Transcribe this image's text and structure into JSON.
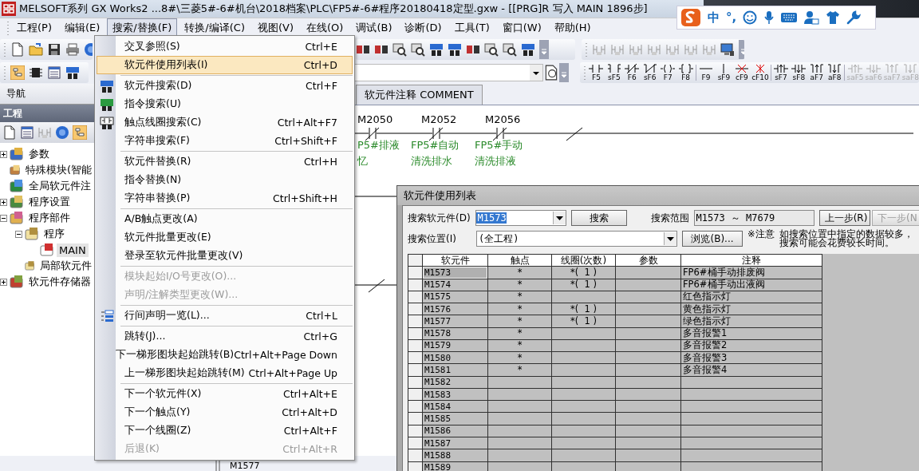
{
  "window": {
    "title": "MELSOFT系列 GX Works2 ...8#\\三菱5#-6#机台\\2018档案\\PLC\\FP5#-6#程序20180418定型.gxw - [[PRG]R 写入 MAIN 1896步]"
  },
  "ime_bar": {
    "mode": "中",
    "punctuation": "°,"
  },
  "menu_bar": [
    {
      "label": "工程(P)",
      "selected": false
    },
    {
      "label": "编辑(E)",
      "selected": false
    },
    {
      "label": "搜索/替换(F)",
      "selected": true
    },
    {
      "label": "转换/编译(C)",
      "selected": false
    },
    {
      "label": "视图(V)",
      "selected": false
    },
    {
      "label": "在线(O)",
      "selected": false
    },
    {
      "label": "调试(B)",
      "selected": false
    },
    {
      "label": "诊断(D)",
      "selected": false
    },
    {
      "label": "工具(T)",
      "selected": false
    },
    {
      "label": "窗口(W)",
      "selected": false
    },
    {
      "label": "帮助(H)",
      "selected": false
    }
  ],
  "menu": [
    {
      "kind": "item",
      "label": "交叉参照(S)",
      "shortcut": "Ctrl+E",
      "selected": false,
      "disabled": false
    },
    {
      "kind": "item",
      "label": "软元件使用列表(I)",
      "shortcut": "Ctrl+D",
      "selected": true,
      "disabled": false
    },
    {
      "kind": "separator"
    },
    {
      "kind": "dev-item",
      "label": "软元件搜索(D)",
      "shortcut": "Ctrl+F",
      "selected": false,
      "disabled": false
    },
    {
      "kind": "instruction-item",
      "label": "指令搜索(U)",
      "selected": false,
      "disabled": false
    },
    {
      "kind": "contact-item",
      "label": "触点线圈搜索(C)",
      "shortcut": "Ctrl+Alt+F7",
      "selected": false,
      "disabled": false
    },
    {
      "kind": "item",
      "label": "字符串搜索(F)",
      "shortcut": "Ctrl+Shift+F",
      "selected": false,
      "disabled": false
    },
    {
      "kind": "separator"
    },
    {
      "kind": "item",
      "label": "软元件替换(R)",
      "shortcut": "Ctrl+H",
      "selected": false,
      "disabled": false
    },
    {
      "kind": "item",
      "label": "指令替换(N)",
      "selected": false,
      "disabled": false
    },
    {
      "kind": "item",
      "label": "字符串替换(P)",
      "shortcut": "Ctrl+Shift+H",
      "selected": false,
      "disabled": false
    },
    {
      "kind": "separator"
    },
    {
      "kind": "item",
      "label": "A/B触点更改(A)",
      "selected": false,
      "disabled": false
    },
    {
      "kind": "item",
      "label": "软元件批量更改(E)",
      "selected": false,
      "disabled": false
    },
    {
      "kind": "item",
      "label": "登录至软元件批量更改(V)",
      "selected": false,
      "disabled": false
    },
    {
      "kind": "separator"
    },
    {
      "kind": "item",
      "label": "模块起始I/O号更改(O)...",
      "selected": false,
      "disabled": true
    },
    {
      "kind": "item",
      "label": "声明/注解类型更改(W)...",
      "selected": false,
      "disabled": true
    },
    {
      "kind": "separator"
    },
    {
      "kind": "statement-item",
      "label": "行间声明一览(L)...",
      "shortcut": "Ctrl+L",
      "selected": false,
      "disabled": false
    },
    {
      "kind": "separator"
    },
    {
      "kind": "item",
      "label": "跳转(J)...",
      "shortcut": "Ctrl+G",
      "selected": false,
      "disabled": false
    },
    {
      "kind": "item",
      "label": "下一梯形图块起始跳转(B)",
      "shortcut": "Ctrl+Alt+Page Down",
      "selected": false,
      "disabled": false
    },
    {
      "kind": "item",
      "label": "上一梯形图块起始跳转(M)",
      "shortcut": "Ctrl+Alt+Page Up",
      "selected": false,
      "disabled": false
    },
    {
      "kind": "separator"
    },
    {
      "kind": "item",
      "label": "下一个软元件(X)",
      "shortcut": "Ctrl+Alt+E",
      "selected": false,
      "disabled": false
    },
    {
      "kind": "item",
      "label": "下一个触点(Y)",
      "shortcut": "Ctrl+Alt+D",
      "selected": false,
      "disabled": false
    },
    {
      "kind": "item",
      "label": "下一个线圈(Z)",
      "shortcut": "Ctrl+Alt+F",
      "selected": false,
      "disabled": false
    },
    {
      "kind": "item",
      "label": "后退(K)",
      "shortcut": "Ctrl+Alt+R",
      "selected": false,
      "disabled": true
    }
  ],
  "ladder_tools": [
    [
      {
        "label": "F5",
        "kind": "open",
        "disabled": false
      },
      {
        "label": "sF5",
        "kind": "open-branch",
        "disabled": false
      },
      {
        "label": "F6",
        "kind": "closed",
        "disabled": false
      },
      {
        "label": "sF6",
        "kind": "closed-branch",
        "disabled": false
      },
      {
        "label": "F7",
        "kind": "coil",
        "disabled": false
      },
      {
        "label": "F8",
        "kind": "instruction",
        "disabled": false
      }
    ],
    [
      {
        "label": "F9",
        "kind": "hline",
        "disabled": false
      },
      {
        "label": "sF9",
        "kind": "vline",
        "disabled": false
      },
      {
        "label": "cF9",
        "kind": "hdelete",
        "disabled": false
      },
      {
        "label": "cF10",
        "kind": "vdelete",
        "disabled": false
      }
    ],
    [
      {
        "label": "sF7",
        "kind": "rise",
        "disabled": false
      },
      {
        "label": "sF8",
        "kind": "fall",
        "disabled": false
      },
      {
        "label": "aF7",
        "kind": "rise-branch",
        "disabled": false
      },
      {
        "label": "aF8",
        "kind": "fall-branch",
        "disabled": false
      }
    ],
    [
      {
        "label": "saF5",
        "kind": "rise",
        "disabled": true
      },
      {
        "label": "saF6",
        "kind": "fall",
        "disabled": true
      },
      {
        "label": "saF7",
        "kind": "rise-branch",
        "disabled": true
      },
      {
        "label": "saF8",
        "kind": "fall-branch",
        "disabled": true
      }
    ]
  ],
  "navigation": {
    "title": "导航",
    "panel_title": "工程",
    "tree": [
      {
        "label": "参数",
        "kind": "parameter",
        "expanded": false,
        "selected": false
      },
      {
        "label": "特殊模块(智能",
        "kind": "module",
        "selected": false
      },
      {
        "label": "全局软元件注",
        "kind": "comment",
        "selected": false
      },
      {
        "label": "程序设置",
        "kind": "settings",
        "expanded": false,
        "selected": false
      },
      {
        "label": "程序部件",
        "kind": "parts",
        "expanded": true,
        "selected": false,
        "children": [
          {
            "label": "程序",
            "kind": "folder",
            "expanded": true,
            "selected": false,
            "children": [
              {
                "label": "MAIN",
                "kind": "program",
                "selected": true
              }
            ]
          },
          {
            "label": "局部软元件",
            "kind": "folder",
            "selected": false
          }
        ]
      },
      {
        "label": "软元件存储器",
        "kind": "memory",
        "expanded": false,
        "selected": false
      }
    ]
  },
  "editor_tabs": [
    {
      "label": "软元件注释 COMMENT",
      "selected": false
    }
  ],
  "ladder": {
    "contacts": [
      {
        "device": "M2050",
        "comment": [
          "P5#排液",
          "忆"
        ]
      },
      {
        "device": "M2052",
        "comment": [
          "FP5#自动",
          "清洗排水"
        ]
      },
      {
        "device": "M2056",
        "comment": [
          "FP5#手动",
          "清洗排液"
        ]
      }
    ],
    "bottom_device": "M1577"
  },
  "dialog": {
    "title": "软元件使用列表",
    "device_label": "搜索软元件(D)",
    "device_value": "M1573",
    "search_button": "搜索",
    "range_label": "搜索范围",
    "range_value": "M1573 ～ M7679",
    "prev_button": {
      "label": "上一步(R)",
      "disabled": false
    },
    "next_button": {
      "label": "下一步(N",
      "disabled": true
    },
    "location_label": "搜索位置(I)",
    "location_value": "(全工程)",
    "browse_button": "浏览(B)...",
    "note_mark": "※注意",
    "note": [
      "如搜索位置中指定的数据较多，",
      "搜索可能会花费较长时间。"
    ],
    "table": {
      "columns": [
        "软元件",
        "触点",
        "线圈(次数)",
        "参数",
        "注释"
      ],
      "rows": [
        {
          "device": "M1573",
          "contact": "*",
          "coil": "*(  1 )",
          "comment": "FP6#桶手动排废阀",
          "focused": true
        },
        {
          "device": "M1574",
          "contact": "*",
          "coil": "*(  1 )",
          "comment": "FP6#桶手动出液阀",
          "focused": false
        },
        {
          "device": "M1575",
          "contact": "*",
          "comment": "红色指示灯",
          "focused": false
        },
        {
          "device": "M1576",
          "contact": "*",
          "coil": "*(  1 )",
          "comment": "黄色指示灯",
          "focused": false
        },
        {
          "device": "M1577",
          "contact": "*",
          "coil": "*(  1 )",
          "comment": "绿色指示灯",
          "focused": false
        },
        {
          "device": "M1578",
          "contact": "*",
          "comment": "多音报警1",
          "focused": false
        },
        {
          "device": "M1579",
          "contact": "*",
          "comment": "多音报警2",
          "focused": false
        },
        {
          "device": "M1580",
          "contact": "*",
          "comment": "多音报警3",
          "focused": false
        },
        {
          "device": "M1581",
          "contact": "*",
          "comment": "多音报警4",
          "focused": false
        },
        {
          "device": "M1582",
          "focused": false
        },
        {
          "device": "M1583",
          "focused": false
        },
        {
          "device": "M1584",
          "focused": false
        },
        {
          "device": "M1585",
          "focused": false
        },
        {
          "device": "M1586",
          "focused": false
        },
        {
          "device": "M1587",
          "focused": false
        },
        {
          "device": "M1588",
          "focused": false
        },
        {
          "device": "M1589",
          "focused": false
        }
      ]
    }
  }
}
